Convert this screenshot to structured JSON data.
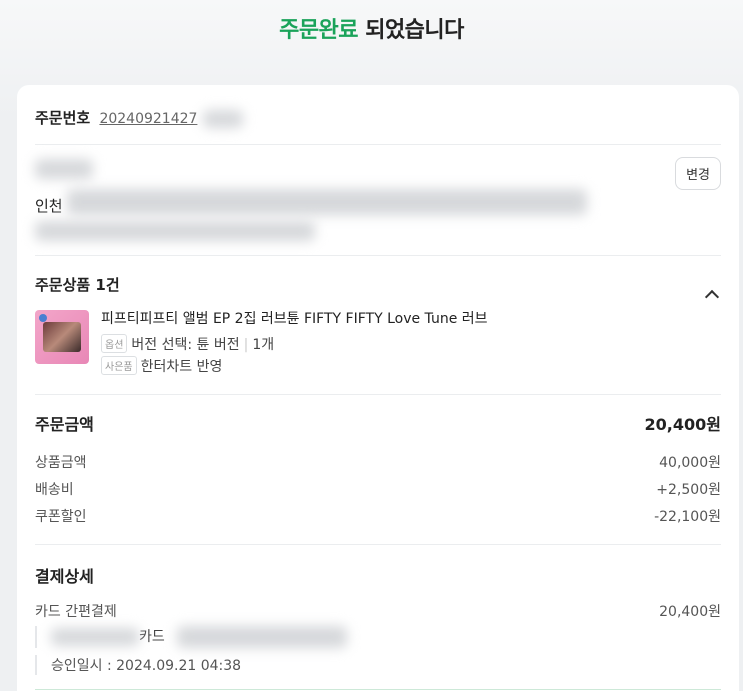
{
  "header": {
    "title_accent": "주문완료",
    "title_rest": " 되었습니다"
  },
  "order": {
    "label": "주문번호",
    "number": "20240921427"
  },
  "address": {
    "city": "인천",
    "change_label": "변경"
  },
  "products": {
    "title": "주문상품 1건",
    "items": [
      {
        "name": "피프티피프티 앨범 EP 2집 러브튠 FIFTY FIFTY Love Tune 러브",
        "option_tag": "옵션",
        "option": "버전 선택: 튠 버전",
        "quantity": "1개",
        "gift_tag": "사은품",
        "gift": "한터차트 반영"
      }
    ]
  },
  "amount": {
    "title": "주문금액",
    "total": "20,400원",
    "rows": [
      {
        "label": "상품금액",
        "value": "40,000원"
      },
      {
        "label": "배송비",
        "value": "+2,500원"
      },
      {
        "label": "쿠폰할인",
        "value": "-22,100원"
      }
    ]
  },
  "payment": {
    "title": "결제상세",
    "method": "카드 간편결제",
    "method_amount": "20,400원",
    "card_suffix": "카드",
    "approval": "승인일시 : 2024.09.21 04:38"
  },
  "colors": {
    "accent": "#1aa35a"
  }
}
